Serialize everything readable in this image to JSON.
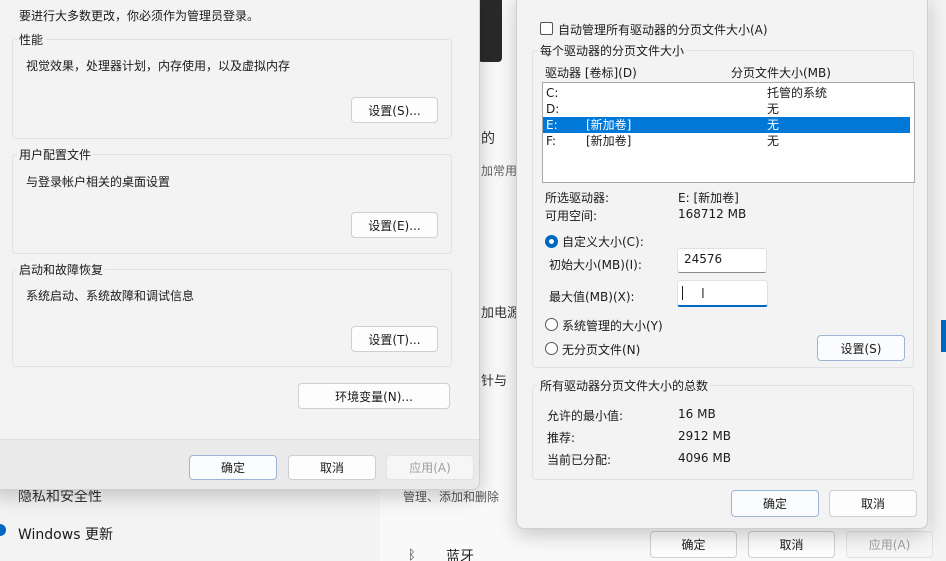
{
  "background_settings": {
    "sidebar_items": [
      "隐私和安全性",
      "Windows 更新"
    ],
    "frag_1": "的",
    "frag_2": "加常用",
    "frag_3": "加电源",
    "frag_4": "针与",
    "frag_5": "管理、添加和删除",
    "frag_6": "蓝牙",
    "bottom_buttons": {
      "ok": "确定",
      "cancel": "取消",
      "apply": "应用(A)"
    }
  },
  "perf_dialog": {
    "admin_notice": "要进行大多数更改，你必须作为管理员登录。",
    "performance": {
      "title": "性能",
      "desc": "视觉效果，处理器计划，内存使用，以及虚拟内存",
      "button": "设置(S)..."
    },
    "user_profiles": {
      "title": "用户配置文件",
      "desc": "与登录帐户相关的桌面设置",
      "button": "设置(E)..."
    },
    "startup": {
      "title": "启动和故障恢复",
      "desc": "系统启动、系统故障和调试信息",
      "button": "设置(T)..."
    },
    "env_button": "环境变量(N)...",
    "ok": "确定",
    "cancel": "取消",
    "apply": "应用(A)"
  },
  "vm_dialog": {
    "auto_manage_label": "自动管理所有驱动器的分页文件大小(A)",
    "auto_manage_checked": false,
    "per_drive_title": "每个驱动器的分页文件大小",
    "col_drive": "驱动器 [卷标](D)",
    "col_size": "分页文件大小(MB)",
    "drives": [
      {
        "drive": "C:",
        "label": "",
        "size": "托管的系统"
      },
      {
        "drive": "D:",
        "label": "",
        "size": "无"
      },
      {
        "drive": "E:",
        "label": "[新加卷]",
        "size": "无"
      },
      {
        "drive": "F:",
        "label": "[新加卷]",
        "size": "无"
      }
    ],
    "selected_drive_label": "所选驱动器:",
    "selected_drive_value": "E:  [新加卷]",
    "free_space_label": "可用空间:",
    "free_space_value": "168712 MB",
    "custom_size_label": "自定义大小(C):",
    "initial_size_label": "初始大小(MB)(I):",
    "initial_size_value": "24576",
    "max_size_label": "最大值(MB)(X):",
    "max_size_value": "",
    "system_managed_label": "系统管理的大小(Y)",
    "no_paging_label": "无分页文件(N)",
    "set_button": "设置(S)",
    "totals_title": "所有驱动器分页文件大小的总数",
    "min_allowed_label": "允许的最小值:",
    "min_allowed_value": "16 MB",
    "recommended_label": "推荐:",
    "recommended_value": "2912 MB",
    "current_label": "当前已分配:",
    "current_value": "4096 MB",
    "ok": "确定",
    "cancel": "取消"
  },
  "colors": {
    "accent": "#0067c0",
    "selection": "#0078d7",
    "dialog_bg": "#f3f3f3"
  }
}
